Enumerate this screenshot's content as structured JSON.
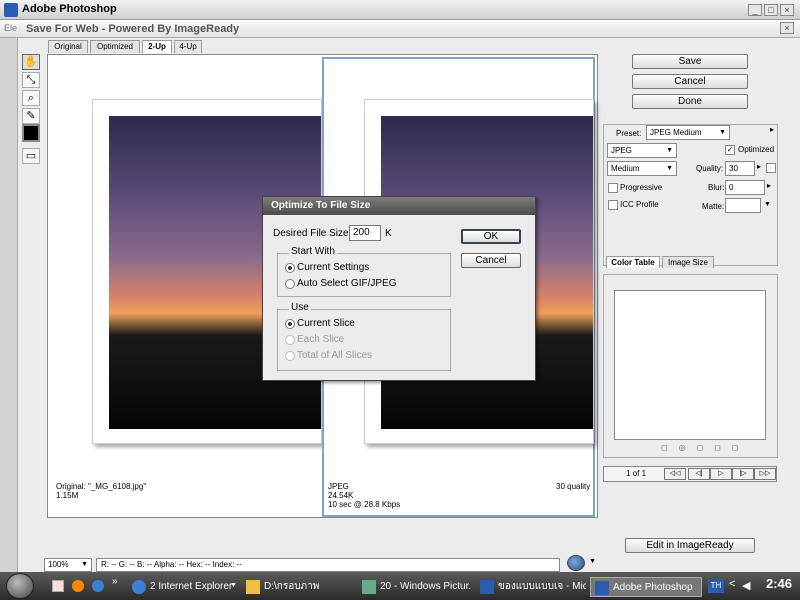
{
  "app": {
    "title": "Adobe Photoshop"
  },
  "window": {
    "title": "Save For Web - Powered By ImageReady"
  },
  "tabs": [
    "Original",
    "Optimized",
    "2-Up",
    "4-Up"
  ],
  "left_pane": {
    "line1": "Original: \"_MG_6108.jpg\"",
    "line2": "1.15M"
  },
  "right_pane": {
    "format": "JPEG",
    "size": "24.54K",
    "time": "10 sec @ 28.8 Kbps",
    "quality": "30 quality"
  },
  "buttons": {
    "save": "Save",
    "cancel": "Cancel",
    "done": "Done",
    "edit_imageready": "Edit in ImageReady"
  },
  "settings": {
    "preset_label": "Preset:",
    "preset_value": "JPEG Medium",
    "format_value": "JPEG",
    "optimized_label": "Optimized",
    "quality_level": "Medium",
    "quality_label": "Quality:",
    "quality_value": "30",
    "progressive_label": "Progressive",
    "blur_label": "Blur:",
    "blur_value": "0",
    "icc_label": "ICC Profile",
    "matte_label": "Matte:"
  },
  "panel_tabs": {
    "color_table": "Color Table",
    "image_size": "Image Size"
  },
  "nav": {
    "page": "1 of 1"
  },
  "bottom": {
    "zoom": "100%",
    "info": "R:  --  G:  --  B:  --  Alpha:  --  Hex:  --  Index:  --"
  },
  "dialog": {
    "title": "Optimize To File Size",
    "desired_label": "Desired File Size:",
    "desired_value": "200",
    "unit": "K",
    "ok": "OK",
    "cancel": "Cancel",
    "start_with_title": "Start With",
    "current_settings": "Current Settings",
    "auto_select": "Auto Select GIF/JPEG",
    "use_title": "Use",
    "current_slice": "Current Slice",
    "each_slice": "Each Slice",
    "total_slices": "Total of All Slices"
  },
  "taskbar": {
    "items": [
      "2 Internet Explorer",
      "D:\\กรอบภาพ",
      "20 - Windows Pictur...",
      "ของแบบแบบเจ - Micros...",
      "Adobe Photoshop"
    ],
    "tray_label": "TH",
    "time": "2:46"
  }
}
